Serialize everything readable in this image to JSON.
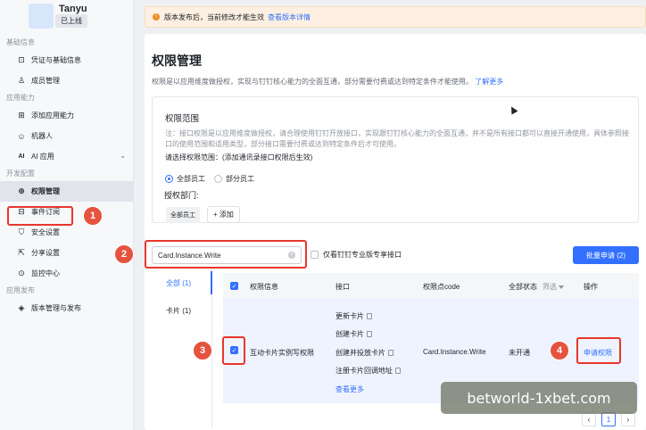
{
  "app": {
    "name": "Tanyu",
    "status": "已上线"
  },
  "sidebar": {
    "sections": [
      {
        "title": "基础信息",
        "items": [
          {
            "label": "凭证与基础信息",
            "icon": "key-icon"
          },
          {
            "label": "成员管理",
            "icon": "user-icon"
          }
        ]
      },
      {
        "title": "应用能力",
        "items": [
          {
            "label": "添加应用能力",
            "icon": "grid-icon"
          },
          {
            "label": "机器人",
            "icon": "robot-icon"
          },
          {
            "label": "AI 应用",
            "icon": "ai-icon"
          }
        ]
      },
      {
        "title": "开发配置",
        "items": [
          {
            "label": "权限管理",
            "icon": "lock-icon"
          },
          {
            "label": "事件订阅",
            "icon": "event-icon"
          },
          {
            "label": "安全设置",
            "icon": "shield-icon"
          },
          {
            "label": "分享设置",
            "icon": "share-icon"
          },
          {
            "label": "监控中心",
            "icon": "monitor-icon"
          }
        ]
      },
      {
        "title": "应用发布",
        "items": [
          {
            "label": "版本管理与发布",
            "icon": "version-icon"
          }
        ]
      }
    ]
  },
  "notice": {
    "text": "版本发布后，当前修改才能生效",
    "link": "查看版本详情"
  },
  "page": {
    "title": "权限管理",
    "desc": "权限是以应用维度做授权，实现与钉钉核心能力的全面互通，部分需要付费或达到特定条件才能使用。",
    "desc_link": "了解更多"
  },
  "scope": {
    "title": "权限范围",
    "note": "注：接口权限是以应用维度做授权，请合理使用钉钉开放接口，实现跟钉钉核心能力的全面互通，并不是所有接口都可以直接开通使用，具体参照接口的使用范围和适用类型，部分接口需要付费或达到特定条件后才可使用。",
    "select_label": "请选择权限范围：(添加通讯录接口权限后生效)",
    "options": [
      "全部员工",
      "部分员工"
    ],
    "dept_label": "授权部门:",
    "dept_tag": "全部员工",
    "add_label": "+ 添加"
  },
  "search": {
    "value": "Card.Instance.Write",
    "clear": "×"
  },
  "pro_only_label": "仅看钉钉专业版专享接口",
  "batch_button": "批量申请 (2)",
  "categories": [
    {
      "label": "全部 (1)"
    },
    {
      "label": "卡片 (1)"
    }
  ],
  "table": {
    "headers": {
      "info": "权限信息",
      "iface": "接口",
      "code": "权限点code",
      "status": "全部状态",
      "filter": "筛选",
      "action": "操作"
    },
    "row": {
      "info": "互动卡片实例写权限",
      "interfaces": [
        "更新卡片",
        "创建卡片",
        "创建并投放卡片",
        "注册卡片回调地址"
      ],
      "more": "查看更多",
      "code": "Card.Instance.Write",
      "status": "未开通",
      "action": "申请权限"
    }
  },
  "pager": {
    "prev": "‹",
    "page": "1",
    "next": "›"
  },
  "badges": [
    "1",
    "2",
    "3",
    "4"
  ],
  "watermark": "betworld-1xbet.com"
}
